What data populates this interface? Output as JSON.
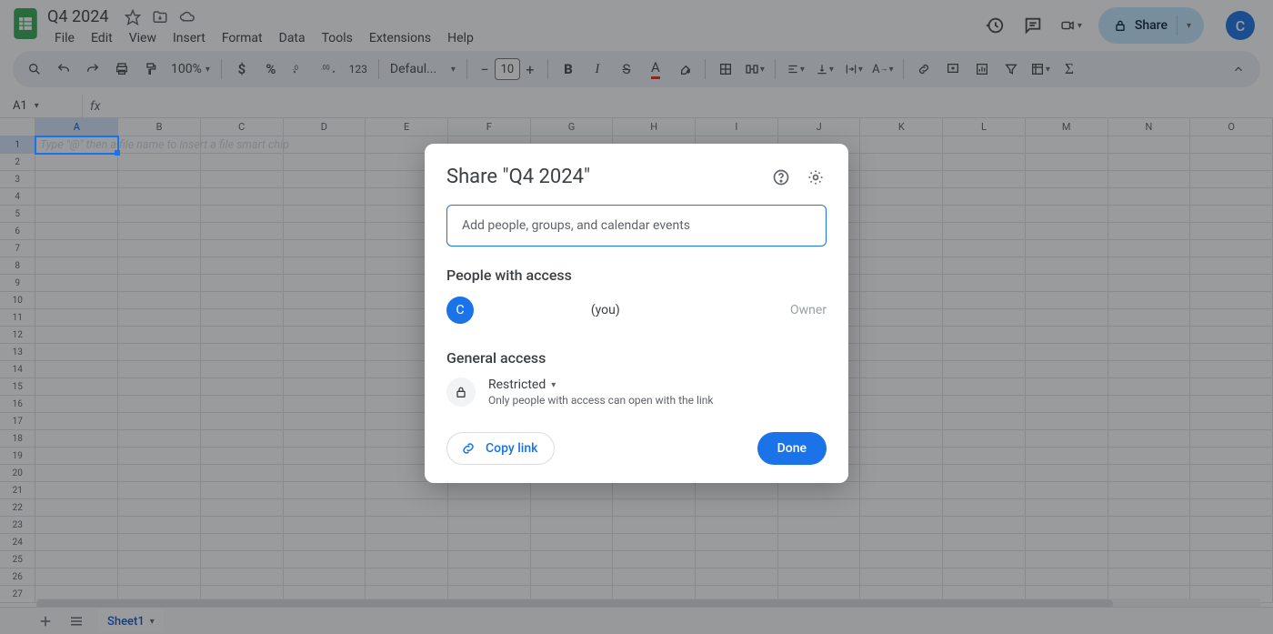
{
  "doc": {
    "name": "Q4 2024"
  },
  "menus": [
    "File",
    "Edit",
    "View",
    "Insert",
    "Format",
    "Data",
    "Tools",
    "Extensions",
    "Help"
  ],
  "share_button": {
    "label": "Share"
  },
  "avatar": {
    "initial": "C"
  },
  "toolbar": {
    "zoom": "100%",
    "font_name": "Defaul...",
    "font_size": "10"
  },
  "namebox": "A1",
  "columns": [
    "A",
    "B",
    "C",
    "D",
    "E",
    "F",
    "G",
    "H",
    "I",
    "J",
    "K",
    "L",
    "M",
    "N",
    "O"
  ],
  "rows": 27,
  "cell_hint": "Type \"@\" then a file name to insert a file smart chip",
  "sheet_tab": "Sheet1",
  "modal": {
    "title": "Share \"Q4 2024\"",
    "add_placeholder": "Add people, groups, and calendar events",
    "people_heading": "People with access",
    "person_you_suffix": "(you)",
    "person_role": "Owner",
    "person_initial": "C",
    "general_heading": "General access",
    "access_level": "Restricted",
    "access_desc": "Only people with access can open with the link",
    "copy_link": "Copy link",
    "done": "Done"
  }
}
